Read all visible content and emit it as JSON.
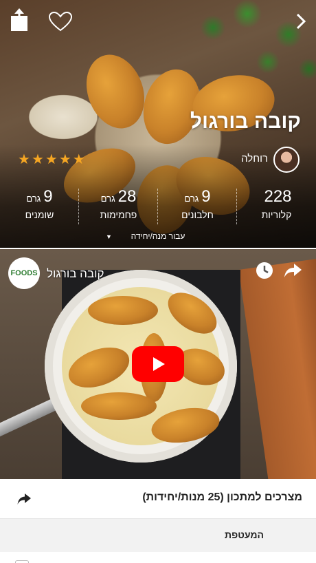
{
  "hero": {
    "title": "קובה בורגול",
    "author": "רוחלה",
    "rating_stars": 5,
    "star_glyph": "★",
    "per_serving_label": "עבור מנה/יחידה",
    "caret": "▼"
  },
  "nutrition": [
    {
      "value": "228",
      "unit": "",
      "label": "קלוריות"
    },
    {
      "value": "9",
      "unit": "גרם",
      "label": "חלבונים"
    },
    {
      "value": "28",
      "unit": "גרם",
      "label": "פחמימות"
    },
    {
      "value": "9",
      "unit": "גרם",
      "label": "שומנים"
    }
  ],
  "video": {
    "title": "קובה בורגול",
    "channel_logo_text": "FOODS"
  },
  "ingredients": {
    "title": "מצרכים למתכון (25 מנות/יחידות)",
    "section": "המעטפת"
  },
  "colors": {
    "star": "#f5a623",
    "play": "#ff0000",
    "section_bg": "#f2f2f2"
  },
  "icons": [
    "share-icon",
    "heart-icon",
    "chevron-right-icon",
    "clock-icon",
    "youtube-play-icon"
  ]
}
